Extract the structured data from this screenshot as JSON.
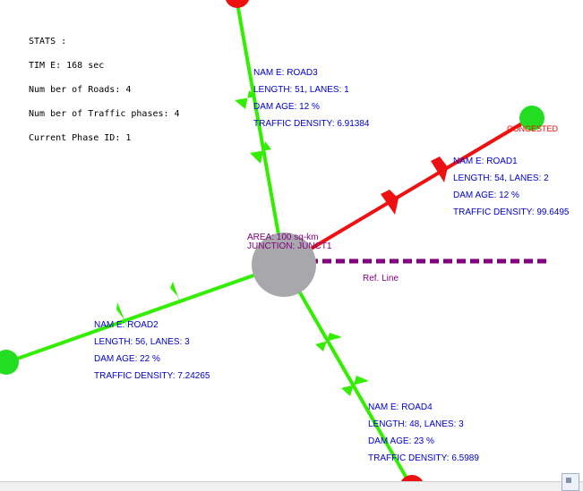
{
  "stats": {
    "heading": "STATS :",
    "time": "TIM E: 168 sec",
    "roads": "Num ber of Roads: 4",
    "phases": "Num ber of Traffic phases: 4",
    "phase_id": "Current Phase ID: 1"
  },
  "junction": {
    "area": "AREA: 100 sq-km",
    "name": "JUNCTION: JUNCT1"
  },
  "reference": {
    "label": "Ref. Line"
  },
  "congested_label": "CONGESTED",
  "roads": [
    {
      "name": "NAM E: ROAD3",
      "length": "LENGTH: 51, LANES: 1",
      "damage": "DAM AGE: 12 %",
      "density": "TRAFFIC DENSITY: 6.91384",
      "status": "normal"
    },
    {
      "name": "NAM E: ROAD1",
      "length": "LENGTH: 54, LANES: 2",
      "damage": "DAM AGE: 12 %",
      "density": "TRAFFIC DENSITY: 99.6495",
      "status": "congested"
    },
    {
      "name": "NAM E: ROAD2",
      "length": "LENGTH: 56, LANES: 3",
      "damage": "DAM AGE: 22 %",
      "density": "TRAFFIC DENSITY: 7.24265",
      "status": "normal"
    },
    {
      "name": "NAM E: ROAD4",
      "length": "LENGTH: 48, LANES: 3",
      "damage": "DAM AGE: 23 %",
      "density": "TRAFFIC DENSITY: 6.5989",
      "status": "normal"
    }
  ],
  "colors": {
    "road_normal": "#33ee00",
    "road_congested": "#ee1111",
    "node_normal": "#22dd22",
    "node_congested": "#ee1111",
    "junction": "#a8a8ac",
    "reference_line": "#800080",
    "info_text": "#0000cc"
  },
  "icons": {
    "junction": "circle-node-icon",
    "endpoint": "circle-node-icon",
    "vehicle": "arrowhead-marker-icon"
  }
}
